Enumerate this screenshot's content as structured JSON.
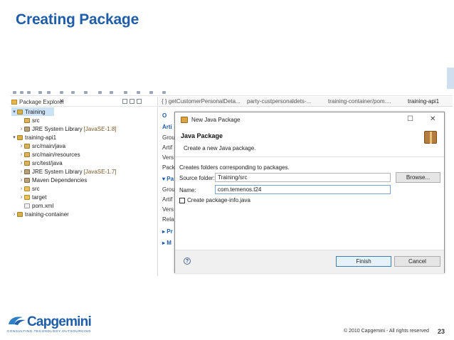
{
  "slide": {
    "title": "Creating Package",
    "page_number": "23",
    "copyright": "© 2010 Capgemini - All rights reserved",
    "logo_text": "Capgemini",
    "logo_tagline": "CONSULTING.TECHNOLOGY.OUTSOURCING"
  },
  "package_explorer": {
    "tab_label": "Package Explorer",
    "close_glyph": "✕",
    "tree": [
      {
        "twisty": "▾",
        "label": "Training",
        "suffix": "",
        "icon": "project-icon"
      },
      {
        "twisty": "",
        "label": "src",
        "suffix": "",
        "icon": "source-folder-icon"
      },
      {
        "twisty": "›",
        "label": "JRE System Library",
        "suffix": "[JavaSE-1.8]",
        "icon": "library-icon"
      },
      {
        "twisty": "▾",
        "label": "training-api1",
        "suffix": "",
        "icon": "project-icon"
      },
      {
        "twisty": "›",
        "label": "src/main/java",
        "suffix": "",
        "icon": "source-folder-icon"
      },
      {
        "twisty": "›",
        "label": "src/main/resources",
        "suffix": "",
        "icon": "source-folder-icon"
      },
      {
        "twisty": "›",
        "label": "src/test/java",
        "suffix": "",
        "icon": "source-folder-icon"
      },
      {
        "twisty": "›",
        "label": "JRE System Library",
        "suffix": "[JavaSE-1.7]",
        "icon": "library-icon"
      },
      {
        "twisty": "›",
        "label": "Maven Dependencies",
        "suffix": "",
        "icon": "library-icon"
      },
      {
        "twisty": "›",
        "label": "src",
        "suffix": "",
        "icon": "folder-icon"
      },
      {
        "twisty": "›",
        "label": "target",
        "suffix": "",
        "icon": "folder-icon"
      },
      {
        "twisty": "",
        "label": "pom.xml",
        "suffix": "",
        "icon": "file-icon"
      },
      {
        "twisty": "›",
        "label": "training-container",
        "suffix": "",
        "icon": "project-icon"
      }
    ]
  },
  "editor": {
    "tabs": [
      {
        "label": "{ } getCustomerPersonalDeta..."
      },
      {
        "label": "party-custpersonaldets-..."
      },
      {
        "label": "training-container/pom...."
      },
      {
        "label": "training-api1"
      }
    ],
    "side_labels": [
      "O",
      "Arti",
      "Grou",
      "Artif",
      "Vers",
      "Pack",
      "▾ Pa",
      "Grou",
      "Artif",
      "Vers",
      "Rela",
      "▸ Pr",
      "▸ M"
    ]
  },
  "dialog": {
    "window_title": "New Java Package",
    "minimize_glyph": "☐",
    "close_glyph": "✕",
    "header_title": "Java Package",
    "header_subtitle": "Create a new Java package.",
    "description": "Creates folders corresponding to packages.",
    "source_folder_label": "Source folder:",
    "source_folder_value": "Training/src",
    "browse_label": "Browse...",
    "name_label": "Name:",
    "name_value": "com.temenos.t24",
    "create_info_label": "Create package-info.java",
    "create_info_checked": false,
    "help_glyph": "?",
    "finish_label": "Finish",
    "cancel_label": "Cancel"
  },
  "colors": {
    "title_blue": "#1f5da8",
    "selection": "#cce3f7"
  }
}
